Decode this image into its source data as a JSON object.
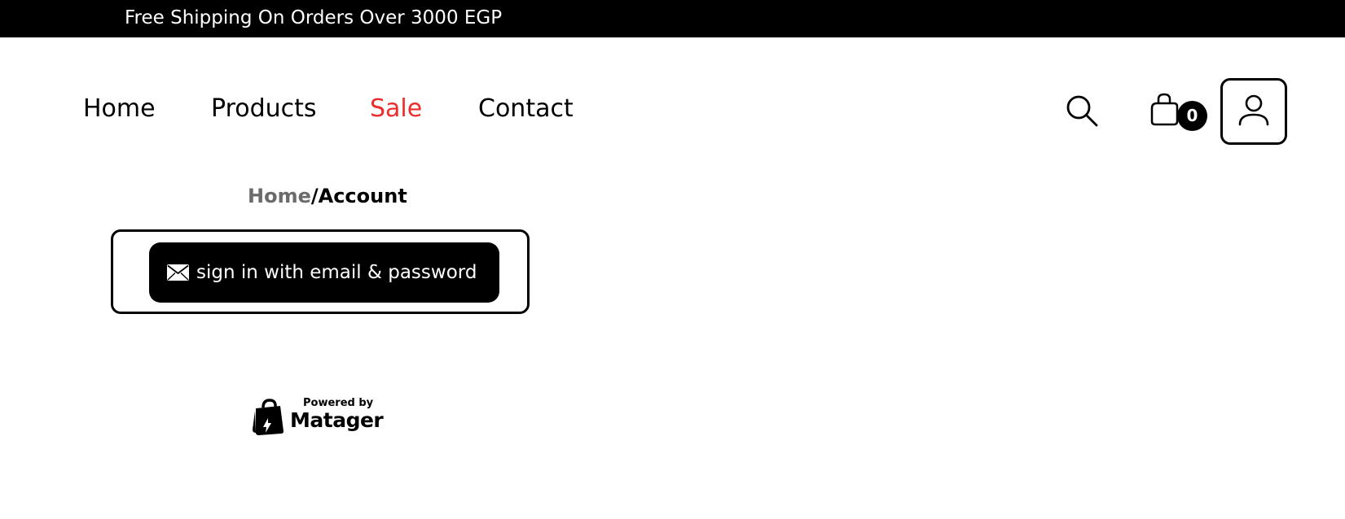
{
  "announcement": {
    "text": "Free Shipping On Orders Over 3000 EGP"
  },
  "nav": {
    "items": [
      {
        "label": "Home",
        "color": "#000000"
      },
      {
        "label": "Products",
        "color": "#000000"
      },
      {
        "label": "Sale",
        "color": "#ed2d2d"
      },
      {
        "label": "Contact",
        "color": "#000000"
      }
    ]
  },
  "header_icons": {
    "search_icon": "search-icon",
    "cart_icon": "shopping-bag-icon",
    "cart_count": "0",
    "account_icon": "user-icon"
  },
  "breadcrumb": {
    "home": "Home",
    "separator": "/",
    "current": "Account"
  },
  "login": {
    "button_label": "sign in with email & password",
    "button_icon": "envelope-icon"
  },
  "footer": {
    "powered_by": "Powered by",
    "brand": "Matager"
  }
}
